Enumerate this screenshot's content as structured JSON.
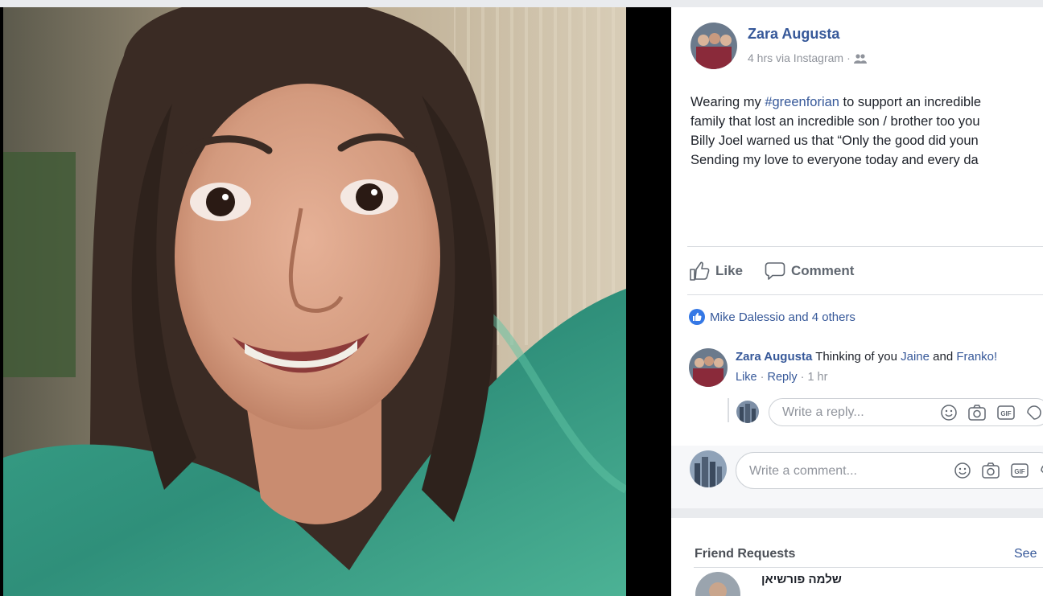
{
  "post": {
    "author": "Zara Augusta",
    "time": "4 hrs",
    "via": "via Instagram",
    "audience_icon": "friends-icon",
    "text_lines": [
      {
        "pre": "Wearing my ",
        "tag": "#greenforian",
        "post": " to support an incredible"
      },
      {
        "text": "family that lost an incredible son / brother too you"
      },
      {
        "text": "Billy Joel warned us that “Only the good did youn"
      },
      {
        "text": "Sending my love to everyone today and every da"
      }
    ]
  },
  "actions": {
    "like": "Like",
    "comment": "Comment"
  },
  "reactions": {
    "summary": "Mike Dalessio and 4 others"
  },
  "comment": {
    "author": "Zara Augusta",
    "text_pre": "Thinking of you ",
    "mention1": "Jaine",
    "and": " and ",
    "mention2": "Franko!",
    "like": "Like",
    "reply": "Reply",
    "time": "1 hr"
  },
  "reply_input": {
    "placeholder": "Write a reply..."
  },
  "comment_input": {
    "placeholder": "Write a comment..."
  },
  "friend_requests": {
    "title": "Friend Requests",
    "see_all": "See",
    "first_name": "שלמה פורשיאן"
  },
  "colors": {
    "link": "#365899",
    "like_badge": "#3578e5",
    "panel_bg": "#ffffff",
    "page_bg": "#e9ebee"
  }
}
